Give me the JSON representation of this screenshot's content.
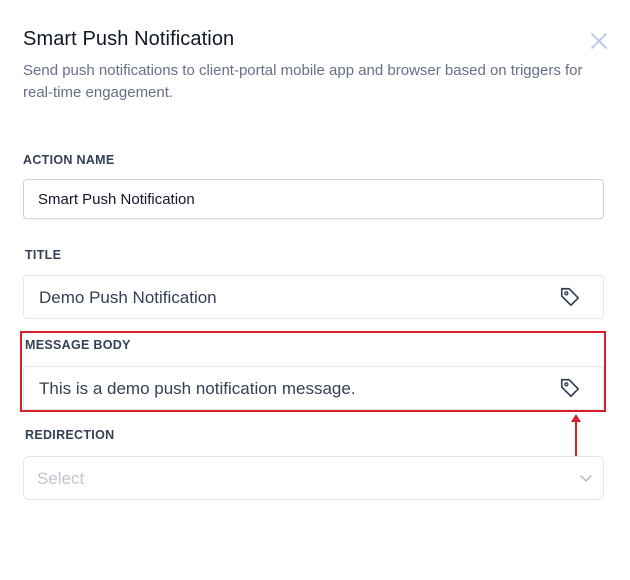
{
  "dialog": {
    "title": "Smart Push Notification",
    "description": "Send push notifications to client-portal mobile app and browser based on triggers for real-time engagement.",
    "close_icon": "close-icon"
  },
  "fields": {
    "action_name": {
      "label": "ACTION NAME",
      "value": "Smart Push Notification"
    },
    "title": {
      "label": "TITLE",
      "value": "Demo Push Notification",
      "icon": "tag-icon"
    },
    "message_body": {
      "label": "MESSAGE BODY",
      "value": "This is a demo push notification message.",
      "icon": "tag-icon"
    },
    "redirection": {
      "label": "REDIRECTION",
      "placeholder": "Select",
      "icon": "chevron-down-icon"
    }
  },
  "annotation": {
    "highlight_color": "#d61f28"
  }
}
